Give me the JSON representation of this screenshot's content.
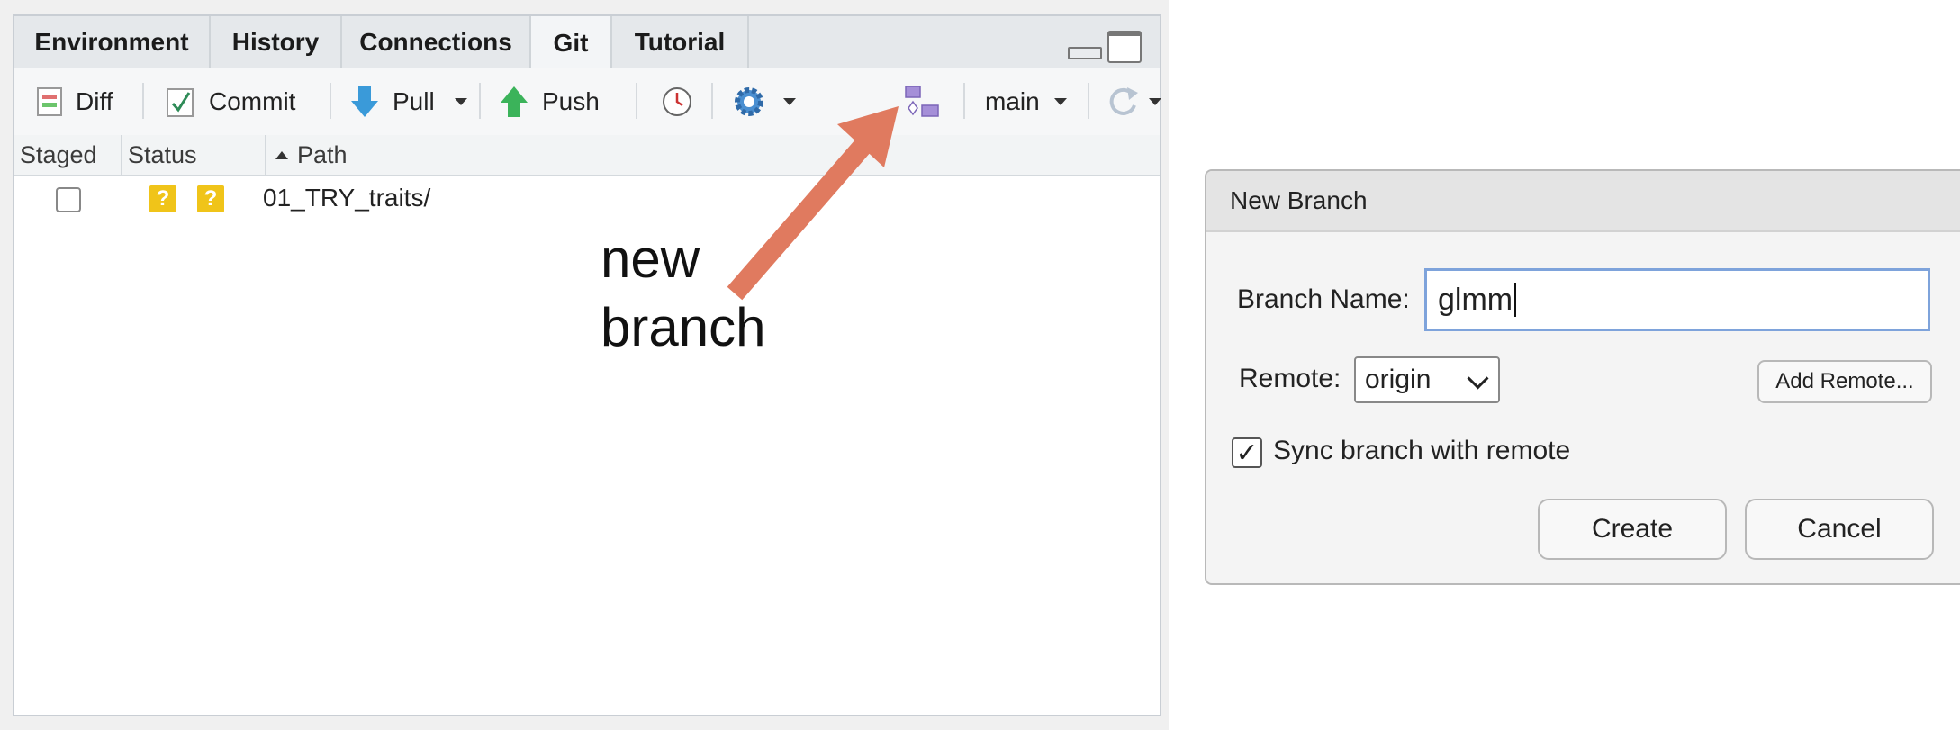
{
  "tabs": [
    {
      "label": "Environment"
    },
    {
      "label": "History"
    },
    {
      "label": "Connections"
    },
    {
      "label": "Git"
    },
    {
      "label": "Tutorial"
    }
  ],
  "toolbar": {
    "diff_label": "Diff",
    "commit_label": "Commit",
    "pull_label": "Pull",
    "push_label": "Push",
    "branch_label": "main"
  },
  "columns": {
    "staged": "Staged",
    "status": "Status",
    "path": "Path"
  },
  "rows": [
    {
      "staged": false,
      "status": [
        "?",
        "?"
      ],
      "path": "01_TRY_traits/"
    }
  ],
  "annotation": {
    "line1": "new",
    "line2": "branch",
    "color": "#e07a5f"
  },
  "dialog": {
    "title": "New Branch",
    "branch_name_label": "Branch Name:",
    "branch_name_value": "glmm",
    "remote_label": "Remote:",
    "remote_value": "origin",
    "add_remote_label": "Add Remote...",
    "sync_checked": true,
    "sync_label": "Sync branch with remote",
    "create_label": "Create",
    "cancel_label": "Cancel"
  },
  "colors": {
    "input_focus": "#7ea3db",
    "status_badge": "#f0c419"
  }
}
